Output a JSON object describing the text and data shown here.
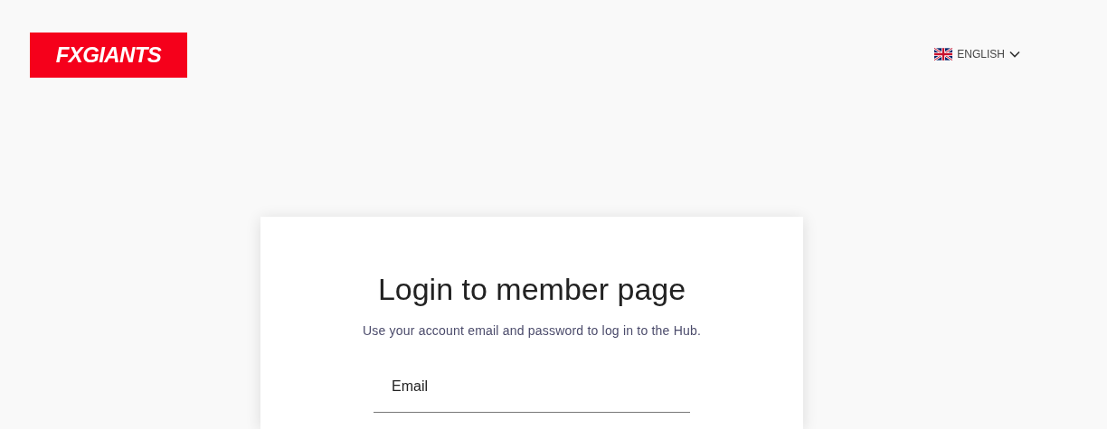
{
  "header": {
    "logo": "FXGIANTS",
    "language": {
      "label": "ENGLISH"
    }
  },
  "login_card": {
    "title": "Login to member page",
    "subtitle": "Use your account email and password to log in to the Hub.",
    "fields": [
      {
        "placeholder": "Email"
      }
    ]
  }
}
